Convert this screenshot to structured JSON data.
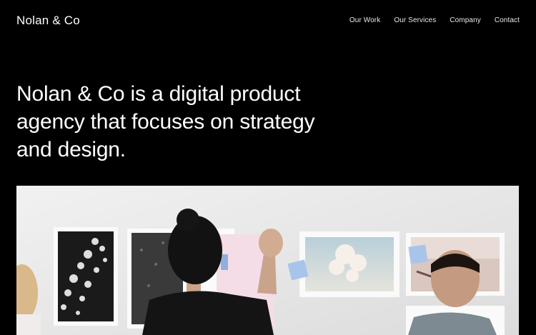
{
  "brand": {
    "name": "Nolan & Co"
  },
  "nav": {
    "items": [
      {
        "label": "Our Work"
      },
      {
        "label": "Our Services"
      },
      {
        "label": "Company"
      },
      {
        "label": "Contact"
      }
    ]
  },
  "hero": {
    "headline": "Nolan & Co is a digital product agency that focuses on strategy and design."
  },
  "photo": {
    "wall_color": "#e9e9e9"
  }
}
